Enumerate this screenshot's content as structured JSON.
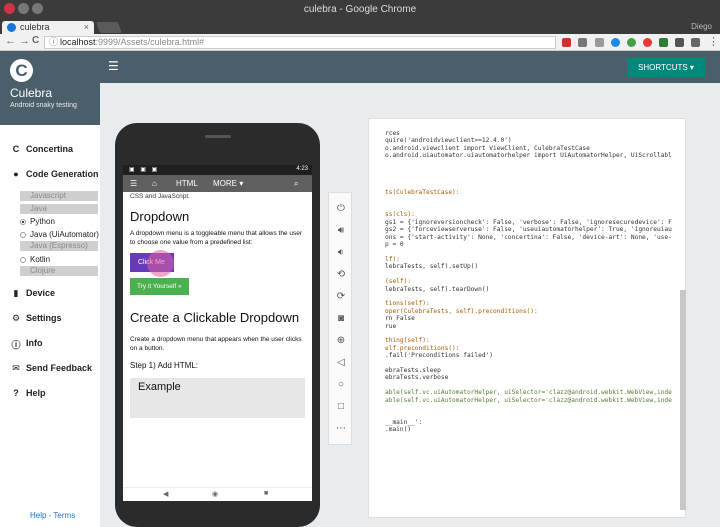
{
  "window": {
    "title": "culebra - Google Chrome",
    "profile": "Diego"
  },
  "tab": {
    "title": "culebra",
    "close": "×"
  },
  "toolbar": {
    "url_host": "localhost",
    "url_port_path": ":9999/Assets/culebra.html#",
    "back": "←",
    "forward": "→",
    "reload": "C"
  },
  "sidebar": {
    "app_name": "Culebra",
    "tagline": "Android snaky testing",
    "logo_letter": "C",
    "items": [
      {
        "label": "Concertina"
      },
      {
        "label": "Code Generation"
      },
      {
        "label": "Device"
      },
      {
        "label": "Settings"
      },
      {
        "label": "Info"
      },
      {
        "label": "Send Feedback"
      },
      {
        "label": "Help"
      }
    ],
    "languages": [
      "Javascript",
      "Java",
      "Python",
      "Java (UiAutomator)",
      "Java (Espresso)",
      "Kotlin",
      "Clojure"
    ],
    "selected_language": "Python",
    "footer_help": "Help",
    "footer_sep": " - ",
    "footer_terms": "Terms"
  },
  "header": {
    "menu_icon": "☰",
    "shortcuts_label": "SHORTCUTS ▾"
  },
  "device": {
    "status_time": "4:23",
    "nav": {
      "home": "⌂",
      "html": "HTML",
      "more": "MORE ▾",
      "search": "⌕"
    },
    "cut_text": "CSS and JavaScript.",
    "h_dropdown": "Dropdown",
    "p_dropdown": "A dropdown menu is a toggleable menu that allows the user to choose one value from a predefined list:",
    "click_me": "Click Me",
    "try_it": "Try it Yourself »",
    "h_clickable": "Create a Clickable Dropdown",
    "p_clickable": "Create a dropdown menu that appears when the user clicks on a button.",
    "step1": "Step 1) Add HTML:",
    "example": "Example"
  },
  "code_lines": [
    "rces",
    "quire('androidviewclient>=12.4.0')",
    "o.android.viewclient import ViewClient, CulebraTestCase",
    "o.android.uiautomator.uiautomatorhelper import UiAutomatorHelper, UiScrollabl",
    "",
    "",
    "",
    "",
    "ts(CulebraTestCase):",
    "",
    "",
    "ss(cls):",
    "gs1 = {'ignoreversioncheck': False, 'verbose': False, 'ignoresecuredevice': F",
    "gs2 = {'forceviewserveruse': False, 'useuiautomatorhelper': True, 'ignoreuiau",
    "ons = {'start-activity': None, 'concertina': False, 'device-art': None, 'use-",
    "p = 0",
    "",
    "lf):",
    "lebraTests, self).setUp()",
    "",
    "(self):",
    "lebraTests, self).tearDown()",
    "",
    "tions(self):",
    "oper(CulebraTests, self).preconditions():",
    "rn False",
    "rue",
    "",
    "thing(self):",
    "elf.preconditions():",
    ".fail('Preconditions failed')",
    "",
    "ebraTests.sleep",
    "ebraTests.verbose",
    "",
    "able(self.vc.uiAutomatorHelper, uiSelector='clazz@android.webkit.WebView,inde",
    "able(self.vc.uiAutomatorHelper, uiSelector='clazz@android.webkit.WebView,inde",
    "",
    "",
    "__main__':",
    ".main()"
  ]
}
